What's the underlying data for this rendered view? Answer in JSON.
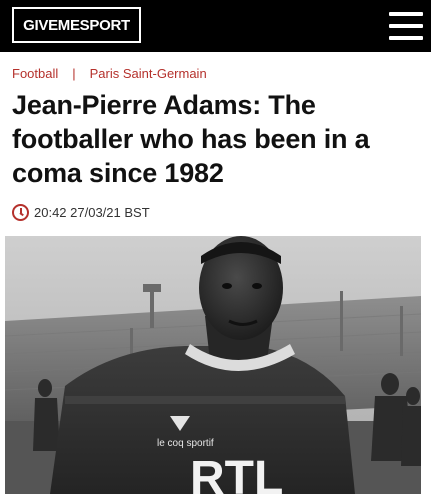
{
  "header": {
    "logo_text": "GIVEMESPORT",
    "menu_icon": "hamburger-menu-icon",
    "background": "#000000"
  },
  "breadcrumb": {
    "items": [
      "Football",
      "Paris Saint-Germain"
    ],
    "separator": "|",
    "color": "#b5312c"
  },
  "article": {
    "title": "Jean-Pierre Adams: The footballer who has been in a coma since 1982",
    "timestamp": "20:42 27/03/21 BST",
    "timestamp_icon": "clock-icon"
  },
  "photo": {
    "jersey_brand": "le coq sportif",
    "jersey_sponsor": "RTL"
  }
}
